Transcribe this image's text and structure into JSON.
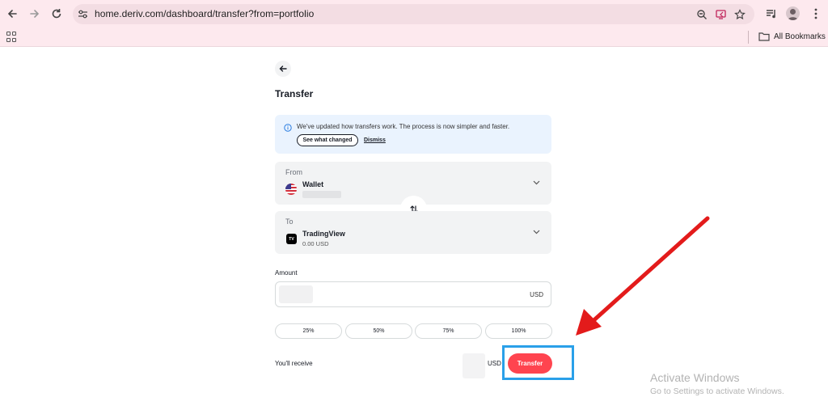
{
  "browser": {
    "url": "home.deriv.com/dashboard/transfer?from=portfolio",
    "bookmarks_label": "All Bookmarks"
  },
  "page": {
    "title": "Transfer"
  },
  "banner": {
    "message": "We've updated how transfers work. The process is now simpler and faster.",
    "see_changed_label": "See what changed",
    "dismiss_label": "Dismiss"
  },
  "from_account": {
    "label": "From",
    "name": "Wallet"
  },
  "to_account": {
    "label": "To",
    "name": "TradingView",
    "balance": "0.00 USD",
    "logo_text": "TV"
  },
  "amount": {
    "label": "Amount",
    "currency": "USD"
  },
  "percent_options": [
    "25%",
    "50%",
    "75%",
    "100%"
  ],
  "receive": {
    "label": "You'll receive",
    "currency": "USD"
  },
  "transfer_button_label": "Transfer",
  "watermark": {
    "title": "Activate Windows",
    "subtitle": "Go to Settings to activate Windows."
  },
  "colors": {
    "accent_red": "#ff444f",
    "highlight_blue": "#2aa0e9",
    "annotation_arrow": "#e31b1b",
    "banner_bg": "#eaf3fe",
    "card_bg": "#f2f3f4"
  }
}
